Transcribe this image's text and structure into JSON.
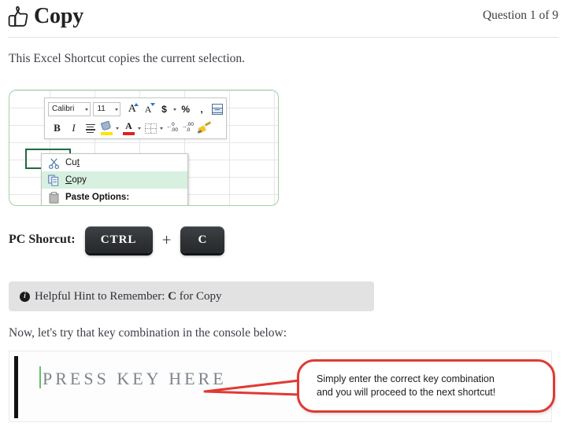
{
  "header": {
    "icon": "thumbs-up-icon",
    "title": "Copy",
    "question_counter": "Question 1 of 9"
  },
  "intro": {
    "text": "This Excel Shortcut copies the current selection."
  },
  "excel_illustration": {
    "mini_toolbar": {
      "font_name": "Calibri",
      "font_size": "11",
      "grow_font": "A",
      "shrink_font": "A",
      "currency": "$",
      "percent": "%",
      "comma": ",",
      "merge_cells": "merge-cells-icon",
      "bold": "B",
      "italic": "I",
      "align": "center-align-icon",
      "fill_color": "fill-color-icon",
      "font_color": "A",
      "borders": "borders-icon",
      "decrease_decimal": "decrease-decimal-icon",
      "increase_decimal": "increase-decimal-icon",
      "format_painter": "format-painter-icon"
    },
    "context_menu": {
      "items": [
        {
          "label": "Cut",
          "icon": "scissors-icon",
          "highlighted": false,
          "bold": false
        },
        {
          "label": "Copy",
          "icon": "copy-icon",
          "highlighted": true,
          "bold": false
        },
        {
          "label": "Paste Options:",
          "icon": "paste-icon",
          "highlighted": false,
          "bold": true
        }
      ]
    },
    "selected_cell_color": "#1d6b3f",
    "highlight_color": "#d7f0e0",
    "border_color": "#9fd2a5"
  },
  "shortcut": {
    "label": "PC Shorcut:",
    "keys": [
      "CTRL",
      "C"
    ],
    "separator": "+"
  },
  "hint": {
    "icon": "info-icon",
    "prefix": "Helpful Hint to Remember: ",
    "key": "C",
    "suffix": " for Copy"
  },
  "console": {
    "prompt": "Now, let's try that key combination in the console below:",
    "placeholder": "PRESS KEY HERE",
    "caret_color": "#6abf69"
  },
  "callout": {
    "line1": "Simply enter the correct key combination",
    "line2": "and you will proceed to the next shortcut!",
    "color": "#e03a33"
  }
}
